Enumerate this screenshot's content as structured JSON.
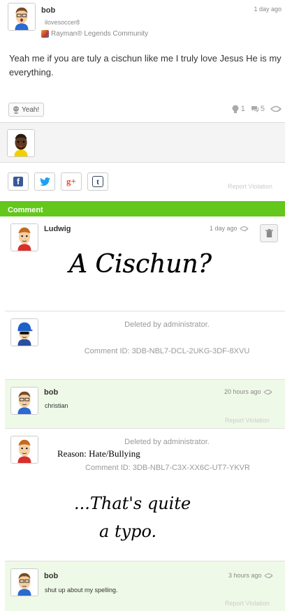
{
  "post": {
    "author": "bob",
    "user_id": "ilovesoccer8",
    "community": "Rayman® Legends Community",
    "timestamp": "1 day ago",
    "body": "Yeah me if you are tuly a cischun like me I truly love Jesus He is my everything.",
    "yeah_label": "Yeah!",
    "yeah_count": "1",
    "comment_count": "5"
  },
  "share": {
    "facebook": "f",
    "google_plus": "g+",
    "tumblr": "t",
    "report_label": "Report Violation"
  },
  "comments_header": "Comment",
  "comments": [
    {
      "author": "Ludwig",
      "timestamp": "1 day ago",
      "handwriting": "A Cischun?"
    },
    {
      "deleted_text": "Deleted by administrator.",
      "comment_id": "Comment ID: 3DB-NBL7-DCL-2UKG-3DF-8XVU"
    },
    {
      "author": "bob",
      "timestamp": "20 hours ago",
      "text": "christian",
      "report_label": "Report Violation"
    },
    {
      "deleted_text": "Deleted by administrator.",
      "reason": "Reason: Hate/Bullying",
      "comment_id": "Comment ID: 3DB-NBL7-C3X-XX6C-UT7-YKVR",
      "handwriting_line1": "...That's quite",
      "handwriting_line2": "a typo."
    },
    {
      "author": "bob",
      "timestamp": "3 hours ago",
      "text": "shut up about my spelling.",
      "report_label": "Report Violation"
    }
  ],
  "colors": {
    "accent_green": "#63c71c",
    "comment_highlight": "#eff9e7",
    "facebook": "#3b5998",
    "twitter": "#1da1f2",
    "google_plus": "#dd4b39",
    "tumblr": "#35465c"
  }
}
